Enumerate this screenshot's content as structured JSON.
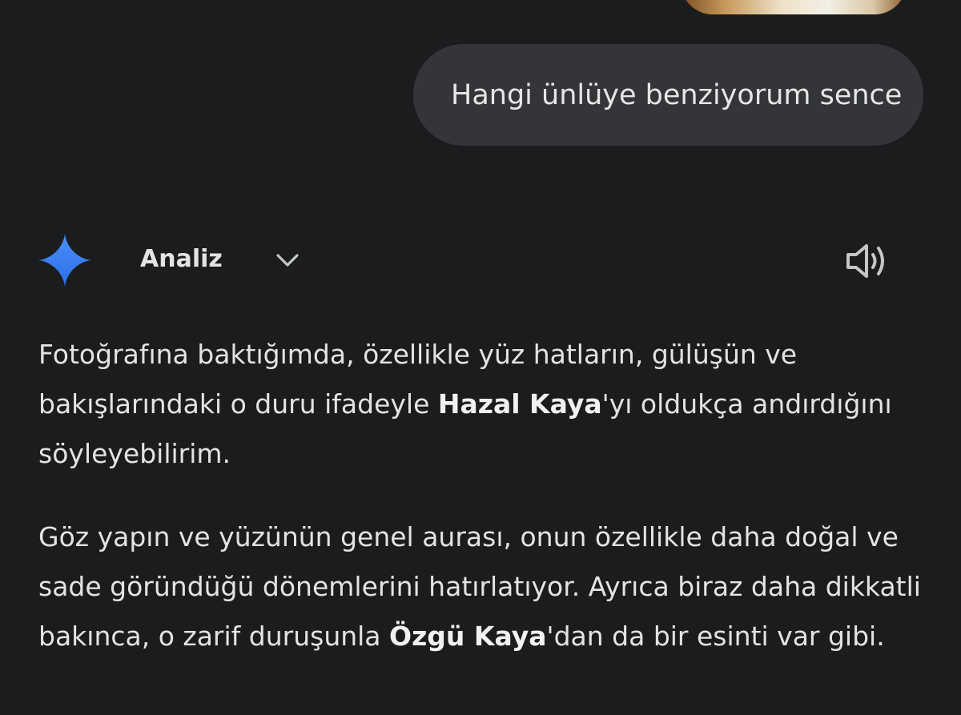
{
  "user_message": {
    "text": "Hangi ünlüye benziyorum sence"
  },
  "response": {
    "mode_label": "Analiz",
    "paragraph1": {
      "pre": "Fotoğrafına baktığımda, özellikle yüz hatların, gülüşün ve bakışlarındaki o duru ifadeyle ",
      "name": "Hazal Kaya",
      "post": "'yı oldukça andırdığını söyleyebilirim."
    },
    "paragraph2": {
      "pre": "Göz yapın ve yüzünün genel aurası, onun özellikle daha doğal ve sade göründüğü dönemlerini hatırlatıyor. Ayrıca biraz daha dikkatli bakınca, o zarif duruşunla ",
      "name": "Özgü Kaya",
      "post": "'dan da bir esinti var gibi."
    }
  },
  "icons": {
    "assistant": "gemini-sparkle-icon",
    "mode_toggle": "chevron-down-icon",
    "read_aloud": "speaker-icon"
  },
  "colors": {
    "background": "#1b1c1e",
    "bubble": "#333538",
    "text": "#e3e3e3",
    "sparkle_top": "#4d8ef7",
    "sparkle_bottom": "#2a6fe8"
  }
}
